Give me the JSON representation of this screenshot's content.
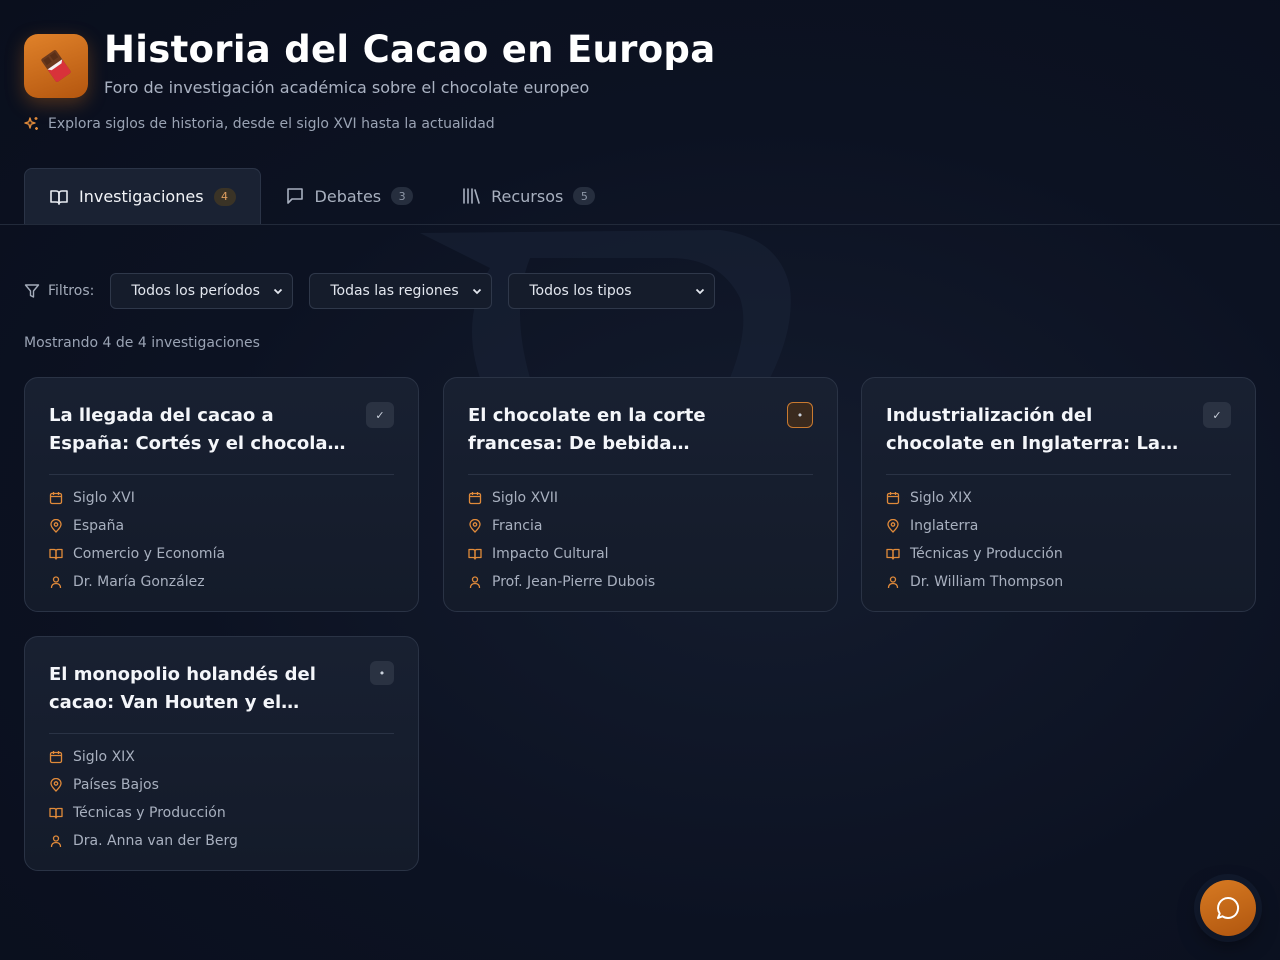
{
  "header": {
    "title": "Historia del Cacao en Europa",
    "subtitle": "Foro de investigación académica sobre el chocolate europeo",
    "tagline": "Explora siglos de historia, desde el siglo XVI hasta la actualidad",
    "logo_icon": "chocolate-bar-icon"
  },
  "tabs": [
    {
      "label": "Investigaciones",
      "count": "4",
      "icon": "book-open-icon",
      "active": true
    },
    {
      "label": "Debates",
      "count": "3",
      "icon": "message-square-icon",
      "active": false
    },
    {
      "label": "Recursos",
      "count": "5",
      "icon": "library-icon",
      "active": false
    }
  ],
  "filters": {
    "label": "Filtros:",
    "period": "Todos los períodos",
    "region": "Todas las regiones",
    "type": "Todos los tipos"
  },
  "results_text": "Mostrando 4 de 4 investigaciones",
  "cards": [
    {
      "title": "La llegada del cacao a España: Cortés y el chocola…",
      "status": "✓",
      "period": "Siglo XVI",
      "region": "España",
      "category": "Comercio y Economía",
      "author": "Dr. María González"
    },
    {
      "title": "El chocolate en la corte francesa: De bebida…",
      "status": "•",
      "period": "Siglo XVII",
      "region": "Francia",
      "category": "Impacto Cultural",
      "author": "Prof. Jean-Pierre Dubois"
    },
    {
      "title": "Industrialización del chocolate en Inglaterra: La…",
      "status": "✓",
      "period": "Siglo XIX",
      "region": "Inglaterra",
      "category": "Técnicas y Producción",
      "author": "Dr. William Thompson"
    },
    {
      "title": "El monopolio holandés del cacao: Van Houten y el…",
      "status": "•",
      "period": "Siglo XIX",
      "region": "Países Bajos",
      "category": "Técnicas y Producción",
      "author": "Dra. Anna van der Berg"
    }
  ],
  "colors": {
    "accent": "#e08a3a",
    "background": "#0c1222",
    "card": "#171f30"
  },
  "chat_icon": "message-circle-icon"
}
